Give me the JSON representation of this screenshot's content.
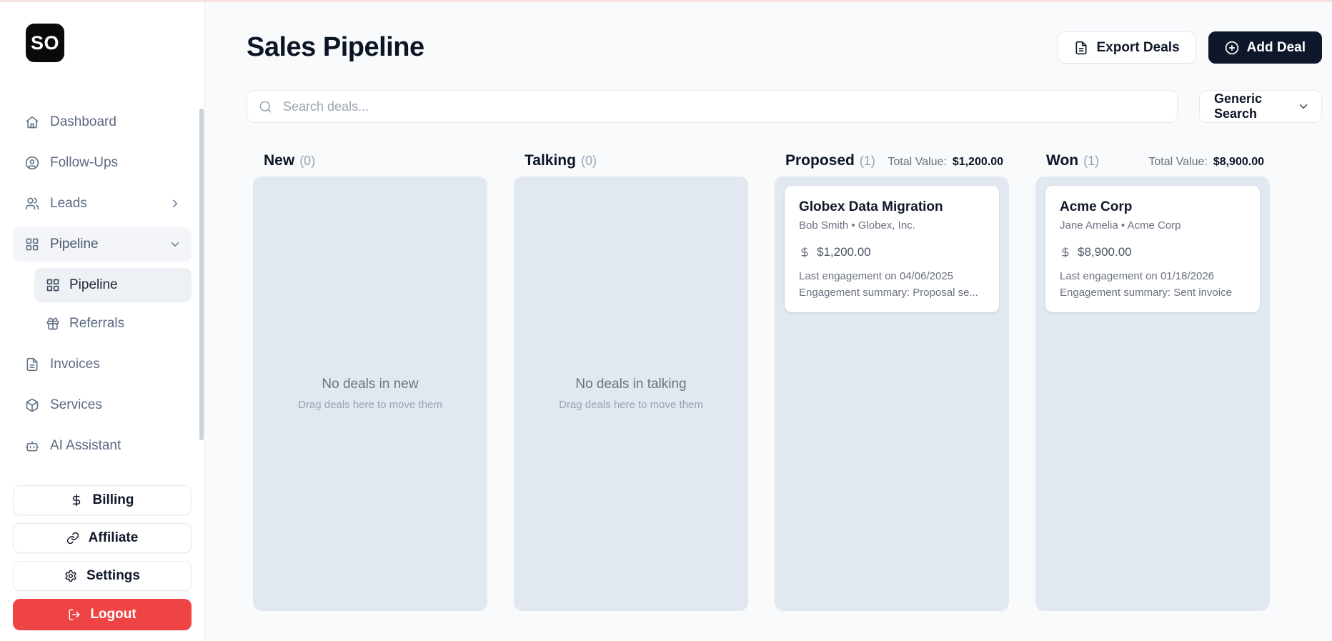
{
  "brand": {
    "logo": "SO"
  },
  "sidebar": {
    "items": {
      "dashboard": "Dashboard",
      "followups": "Follow-Ups",
      "leads": "Leads",
      "pipeline": "Pipeline",
      "pipeline_sub": "Pipeline",
      "referrals": "Referrals",
      "invoices": "Invoices",
      "services": "Services",
      "ai_assistant": "AI Assistant"
    },
    "footer": {
      "billing": "Billing",
      "affiliate": "Affiliate",
      "settings": "Settings",
      "logout": "Logout"
    }
  },
  "header": {
    "title": "Sales Pipeline",
    "export_button": "Export Deals",
    "add_button": "Add Deal"
  },
  "search": {
    "placeholder": "Search deals...",
    "filter": "Generic Search"
  },
  "board": {
    "total_value_label": "Total Value:",
    "columns": [
      {
        "name": "New",
        "count": "(0)",
        "empty_title": "No deals in new",
        "empty_hint": "Drag deals here to move them"
      },
      {
        "name": "Talking",
        "count": "(0)",
        "empty_title": "No deals in talking",
        "empty_hint": "Drag deals here to move them"
      },
      {
        "name": "Proposed",
        "count": "(1)",
        "total_value": "$1,200.00",
        "card": {
          "title": "Globex Data Migration",
          "contact": "Bob Smith • Globex, Inc.",
          "amount": "$1,200.00",
          "engagement": "Last engagement on 04/06/2025",
          "summary": "Engagement summary: Proposal se..."
        }
      },
      {
        "name": "Won",
        "count": "(1)",
        "total_value": "$8,900.00",
        "card": {
          "title": "Acme Corp",
          "contact": "Jane Amelia • Acme Corp",
          "amount": "$8,900.00",
          "engagement": "Last engagement on 01/18/2026",
          "summary": "Engagement summary: Sent invoice"
        }
      }
    ]
  },
  "colors": {
    "accent_dark": "#0f172a",
    "logout_red": "#ef4444",
    "column_bg": "#e2e8f0",
    "sidebar_bg": "#ffffff",
    "page_bg": "#f8fafc"
  }
}
